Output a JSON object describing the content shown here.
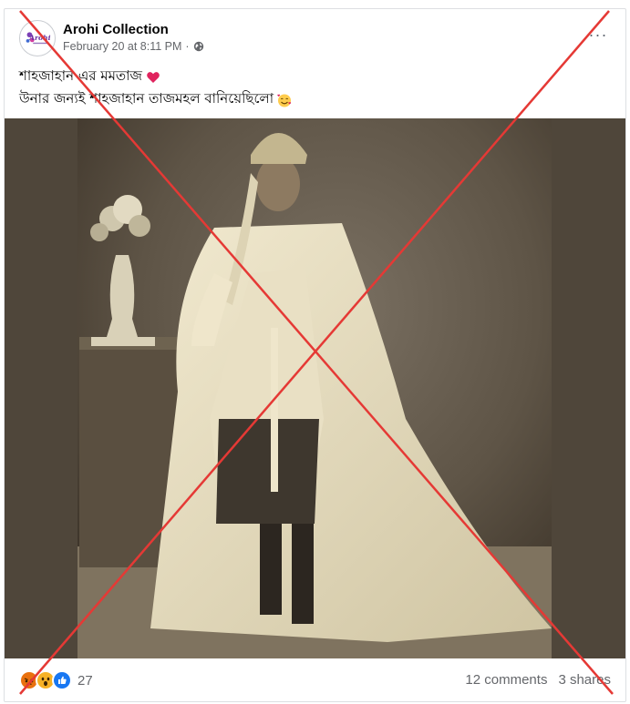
{
  "post": {
    "page_name": "Arohi Collection",
    "avatar_text": "Arohi",
    "date": "February 20 at 8:11 PM",
    "separator": "·",
    "privacy_icon": "globe-icon",
    "more_label": "···",
    "caption_line1": "শাহজাহান এর মমতাজ",
    "caption_line2": "উনার জন্যই শাহজাহান তাজমহল বানিয়েছিলো",
    "photo_icon": "historical-portrait-photo"
  },
  "footer": {
    "reactions": [
      "angry-icon",
      "wow-icon",
      "like-icon"
    ],
    "reaction_count": "27",
    "comments": "12 comments",
    "shares": "3 shares"
  },
  "colors": {
    "cross": "#e53935",
    "like": "#1877f2",
    "wow": "#f7b125",
    "angry": "#e9710f",
    "heart": "#e0245e"
  }
}
